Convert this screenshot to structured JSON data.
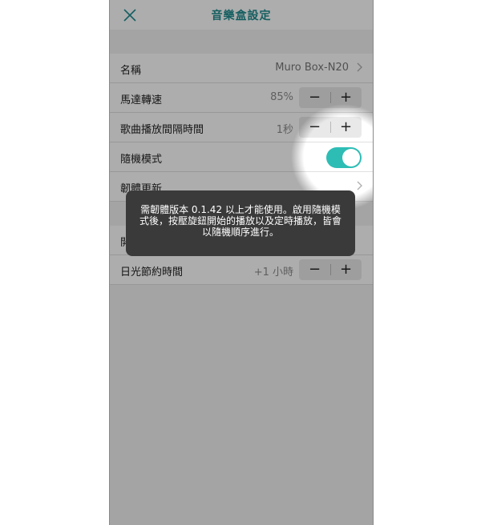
{
  "header": {
    "title": "音樂盒設定",
    "close_icon": "close-icon"
  },
  "settings": {
    "name": {
      "label": "名稱",
      "value": "Muro Box-N20",
      "icon": "chevron-right-icon"
    },
    "motor_speed": {
      "label": "馬達轉速",
      "value": "85%",
      "minus": "−",
      "plus": "+"
    },
    "song_interval": {
      "label": "歌曲播放間隔時間",
      "value": "1秒",
      "minus": "−",
      "plus": "+"
    },
    "shuffle": {
      "label": "隨機模式",
      "enabled": true
    },
    "firmware": {
      "label": "韌體更新",
      "icon": "chevron-right-icon"
    },
    "partial_row": {
      "label": "開"
    },
    "dst": {
      "label": "日光節約時間",
      "value": "+1 小時",
      "minus": "−",
      "plus": "+"
    }
  },
  "tooltip": {
    "text": "需韌體版本 0.1.42 以上才能使用。啟用隨機模式後，按壓旋鈕開始的播放以及定時播放，皆會以隨機順序進行。"
  },
  "colors": {
    "accent": "#2dbdb5",
    "title": "#1f8a8e"
  }
}
